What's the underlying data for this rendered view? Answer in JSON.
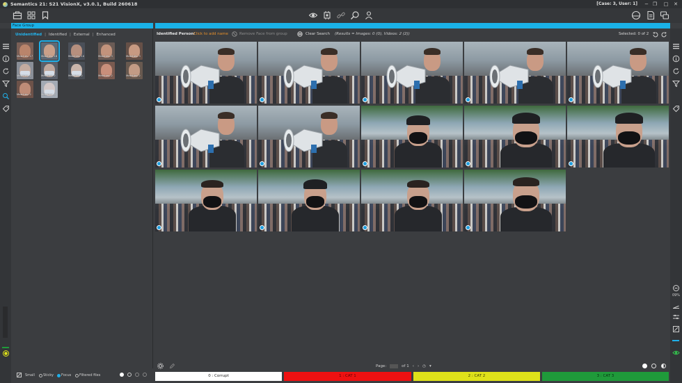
{
  "app": {
    "title": "Semantics 21: S21 VisionX, v3.0.1, Build 260618",
    "case_info": "[Case: 3, User: 1]"
  },
  "window_controls": [
    "−",
    "❐",
    "□",
    "✕"
  ],
  "panel": {
    "title": "Face Group",
    "tabs": [
      {
        "label": "Unidentified",
        "active": true
      },
      {
        "label": "Identified",
        "active": false
      },
      {
        "label": "External",
        "active": false
      },
      {
        "label": "Enhanced",
        "active": false
      }
    ],
    "faces": [
      {
        "label": "Matches: 17",
        "skin": "#b9846b",
        "mask": false,
        "bg": "#7a5f56"
      },
      {
        "label": "Matches: 16",
        "skin": "#caa089",
        "mask": false,
        "bg": "#5e6a76",
        "selected": true
      },
      {
        "label": "Matches: 10",
        "skin": "#b58f7e",
        "mask": false,
        "bg": "#4a4f58"
      },
      {
        "label": "Matches: 3",
        "skin": "#c2937c",
        "mask": false,
        "bg": "#6a5b55"
      },
      {
        "label": "Matches: 3",
        "skin": "#c79a82",
        "mask": false,
        "bg": "#665047"
      },
      {
        "label": "Matches: 2",
        "skin": "#c4ab9f",
        "mask": true,
        "bg": "#8a8f98"
      },
      {
        "label": "Matches: 2",
        "skin": "#bfa79c",
        "mask": true,
        "bg": "#5b606a"
      },
      {
        "label": "Matches: 2",
        "skin": "#c9b5ab",
        "mask": true,
        "bg": "#4a4f56"
      },
      {
        "label": "Matches: 2",
        "skin": "#c98f7b",
        "mask": false,
        "bg": "#795a50"
      },
      {
        "label": "Matches: 2",
        "skin": "#c29b85",
        "mask": false,
        "bg": "#68594f"
      },
      {
        "label": "Matches: 2",
        "skin": "#bf8c77",
        "mask": false,
        "bg": "#6d5249"
      },
      {
        "label": "Matches: 2",
        "skin": "#d3c8c8",
        "mask": true,
        "bg": "#a3aab4"
      }
    ]
  },
  "left_bottom": {
    "small": "Small",
    "sticky": "Sticky",
    "focus": "Focus",
    "filtered": "Filtered files"
  },
  "content_header": {
    "identified_person_label": "Identified Person:",
    "click_to_add": "Click to add name",
    "remove_face": "Remove Face from group",
    "clear_search": "Clear Search",
    "results": "(Results = Images: 0 (0), Videos: 2 (2))",
    "selected": "Selected: 0 of 2"
  },
  "pager": {
    "page_label": "Page:",
    "of_label": "of 1"
  },
  "categories": [
    {
      "label": "0 : Corrupt",
      "color": "#ffffff",
      "text": "#222222"
    },
    {
      "label": "1 : CAT 1",
      "color": "#ee1111",
      "text": "#5a0000"
    },
    {
      "label": "2 : CAT 2",
      "color": "#dfe21a",
      "text": "#3a3a00"
    },
    {
      "label": "3 : CAT 3",
      "color": "#1f9a3a",
      "text": "#053010"
    }
  ],
  "icons": {
    "toolbar_left": [
      "briefcase-icon",
      "grid-icon",
      "bookmark-icon"
    ],
    "toolbar_center": [
      "eye-icon",
      "chip-icon",
      "link-icon",
      "face-search-icon",
      "person-icon"
    ],
    "toolbar_right": [
      "hdd-icon",
      "document-icon",
      "chat-icon"
    ]
  },
  "right_rail_zoom": "09%"
}
